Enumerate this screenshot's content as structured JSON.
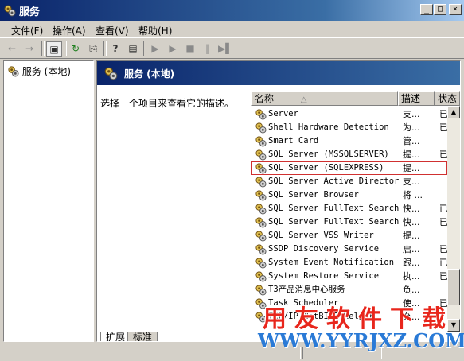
{
  "window": {
    "title": "服务",
    "min_glyph": "_",
    "max_glyph": "□",
    "close_glyph": "×"
  },
  "menu": [
    "文件(F)",
    "操作(A)",
    "查看(V)",
    "帮助(H)"
  ],
  "toolbar": {
    "back": "←",
    "forward": "→",
    "console_tree": "▣",
    "refresh": "↻",
    "export": "⎘",
    "help": "?",
    "properties": "▤",
    "start": "▶",
    "start2": "▶",
    "stop": "■",
    "pause": "‖",
    "restart": "▶▌"
  },
  "tree": {
    "root_label": "服务 (本地)"
  },
  "pane": {
    "header": "服务 (本地)",
    "description": "选择一个项目来查看它的描述。"
  },
  "list": {
    "columns": {
      "name": "名称",
      "sort_arrow": "△",
      "desc": "描述",
      "status": "状态"
    },
    "rows": [
      {
        "name": "Server",
        "desc": "支...",
        "status": "已启"
      },
      {
        "name": "Shell Hardware Detection",
        "desc": "为...",
        "status": "已启"
      },
      {
        "name": "Smart Card",
        "desc": "管...",
        "status": ""
      },
      {
        "name": "SQL Server (MSSQLSERVER)",
        "desc": "提...",
        "status": "已启"
      },
      {
        "name": "SQL Server (SQLEXPRESS)",
        "desc": "提...",
        "status": ""
      },
      {
        "name": "SQL Server Active Director...",
        "desc": "支...",
        "status": ""
      },
      {
        "name": "SQL Server Browser",
        "desc": "将 ...",
        "status": ""
      },
      {
        "name": "SQL Server FullText Search...",
        "desc": "快...",
        "status": "已启"
      },
      {
        "name": "SQL Server FullText Search...",
        "desc": "快...",
        "status": "已启"
      },
      {
        "name": "SQL Server VSS Writer",
        "desc": "提...",
        "status": ""
      },
      {
        "name": "SSDP Discovery Service",
        "desc": "启...",
        "status": "已启"
      },
      {
        "name": "System Event Notification",
        "desc": "跟...",
        "status": "已启"
      },
      {
        "name": "System Restore Service",
        "desc": "执...",
        "status": "已启"
      },
      {
        "name": "T3产品消息中心服务",
        "desc": "负...",
        "status": ""
      },
      {
        "name": "Task Scheduler",
        "desc": "使...",
        "status": "已启"
      },
      {
        "name": "TCP/IP NetBIOS Helper",
        "desc": "允...",
        "status": ""
      }
    ],
    "highlighted_index": 4
  },
  "scrollbar": {
    "up": "▲",
    "down": "▼"
  },
  "tabs": {
    "extended": "扩展",
    "standard": "标准"
  },
  "watermark": {
    "line1": "用友软件下载",
    "line2": "WWW.YYRJXZ.COM"
  },
  "colors": {
    "title_dark": "#0a246a",
    "title_light": "#a6caf0",
    "highlight_box": "#d03030",
    "wm_red": "#e8261c",
    "wm_blue": "#2a7ad6"
  }
}
